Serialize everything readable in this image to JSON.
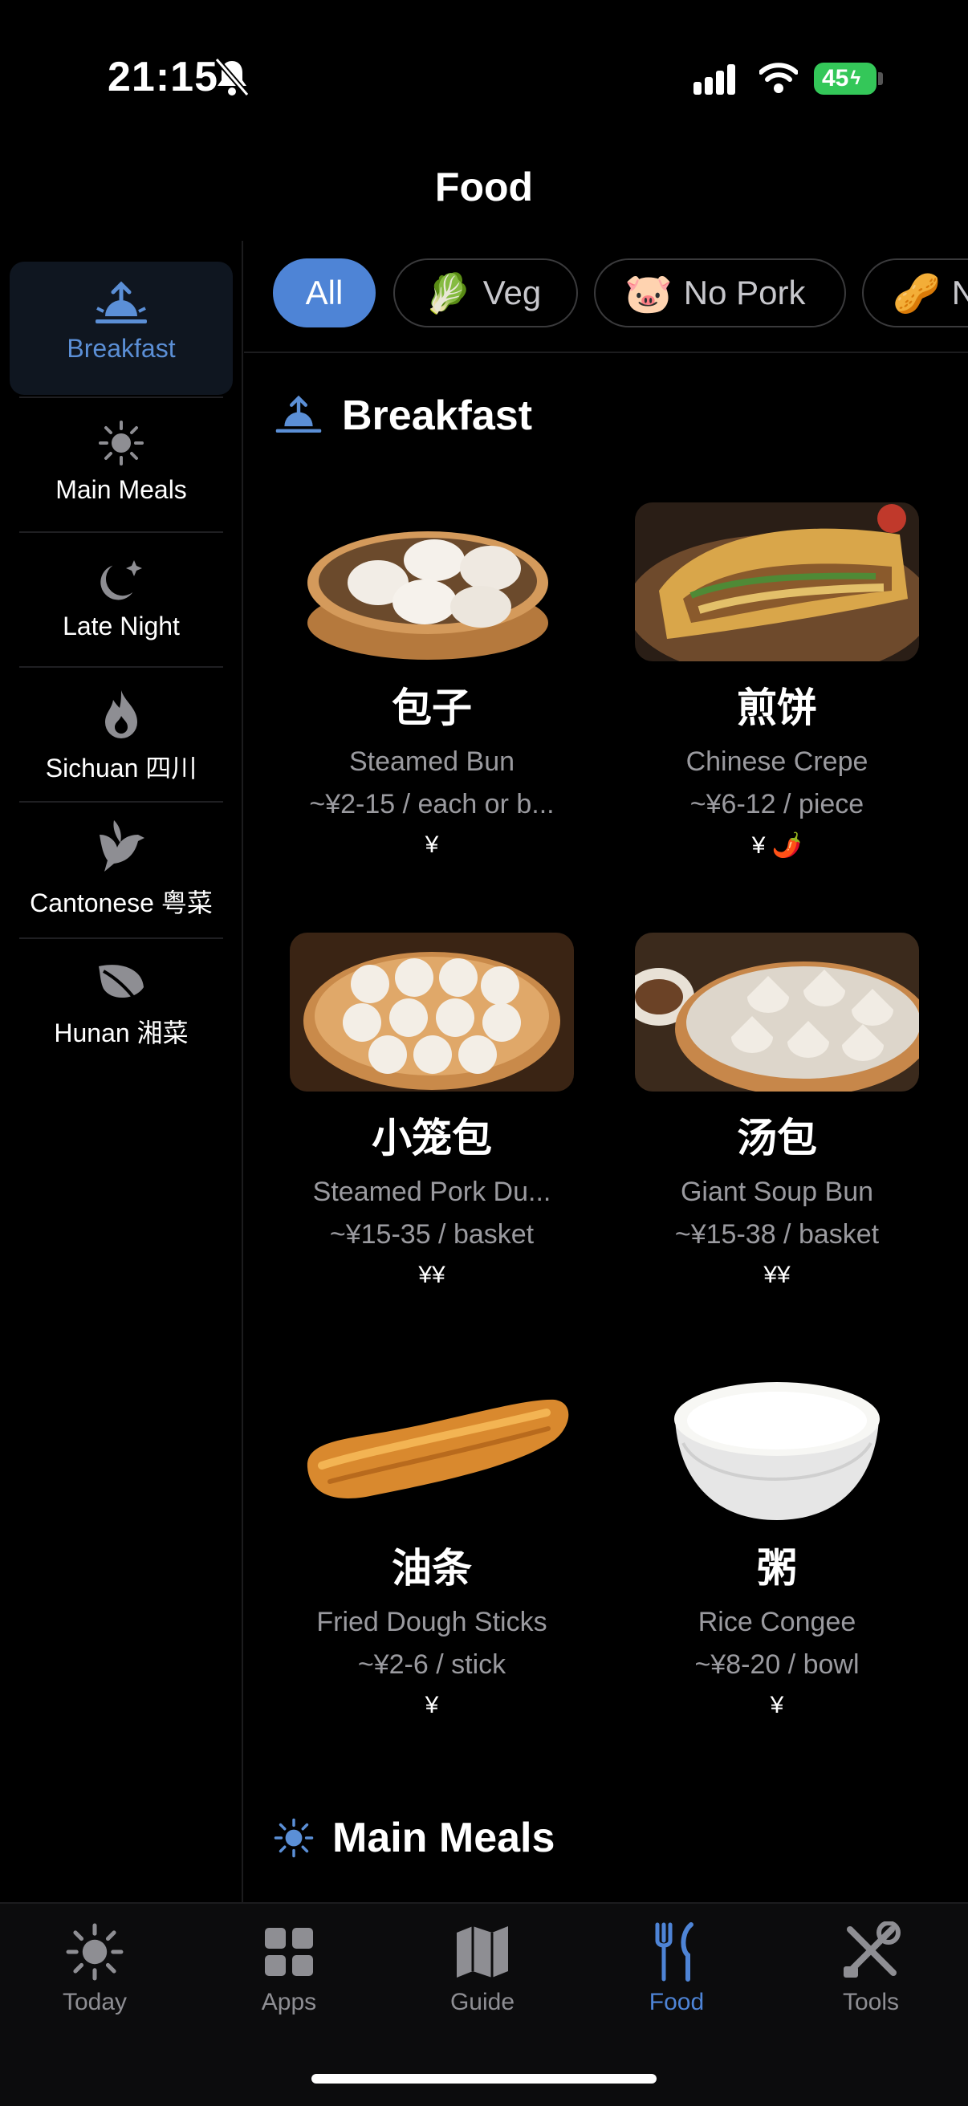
{
  "status_bar": {
    "time": "21:15",
    "battery": "45"
  },
  "header": {
    "title": "Food"
  },
  "sidebar": {
    "items": [
      {
        "label": "Breakfast",
        "icon": "sunrise-icon",
        "active": true
      },
      {
        "label": "Main Meals",
        "icon": "sun-icon"
      },
      {
        "label": "Late Night",
        "icon": "moon-icon"
      },
      {
        "label": "Sichuan 四川",
        "icon": "flame-icon"
      },
      {
        "label": "Cantonese 粤菜",
        "icon": "bird-icon"
      },
      {
        "label": "Hunan 湘菜",
        "icon": "leaf-icon"
      }
    ]
  },
  "filters": [
    {
      "label": "All",
      "active": true
    },
    {
      "label": "Veg",
      "emoji": "🥬"
    },
    {
      "label": "No Pork",
      "emoji": "🐷"
    },
    {
      "label": "N",
      "emoji": "🥜"
    }
  ],
  "sections": {
    "breakfast": {
      "title": "Breakfast",
      "icon": "sunrise-icon"
    },
    "main_meals": {
      "title": "Main Meals",
      "icon": "sun-icon"
    }
  },
  "foods": [
    {
      "name": "包子",
      "en": "Steamed Bun",
      "price": "~¥2-15 / each or b...",
      "tier": "¥",
      "image": "steamed-buns-image"
    },
    {
      "name": "煎饼",
      "en": "Chinese Crepe",
      "price": "~¥6-12 / piece",
      "tier": "¥",
      "spicy": "🌶️",
      "image": "crepe-image"
    },
    {
      "name": "小笼包",
      "en": "Steamed Pork Du...",
      "price": "~¥15-35 / basket",
      "tier": "¥¥",
      "image": "xiaolongbao-image"
    },
    {
      "name": "汤包",
      "en": "Giant Soup Bun",
      "price": "~¥15-38 / basket",
      "tier": "¥¥",
      "image": "soup-bun-image"
    },
    {
      "name": "油条",
      "en": "Fried Dough Sticks",
      "price": "~¥2-6 / stick",
      "tier": "¥",
      "image": "youtiao-image"
    },
    {
      "name": "粥",
      "en": "Rice Congee",
      "price": "~¥8-20 / bowl",
      "tier": "¥",
      "image": "congee-image"
    }
  ],
  "tabbar": {
    "tabs": [
      {
        "label": "Today",
        "icon": "sun-icon"
      },
      {
        "label": "Apps",
        "icon": "grid-icon"
      },
      {
        "label": "Guide",
        "icon": "map-icon"
      },
      {
        "label": "Food",
        "icon": "fork-knife-icon",
        "active": true
      },
      {
        "label": "Tools",
        "icon": "tools-icon"
      }
    ]
  },
  "colors": {
    "accent": "#4e84d6",
    "background": "#000000"
  }
}
